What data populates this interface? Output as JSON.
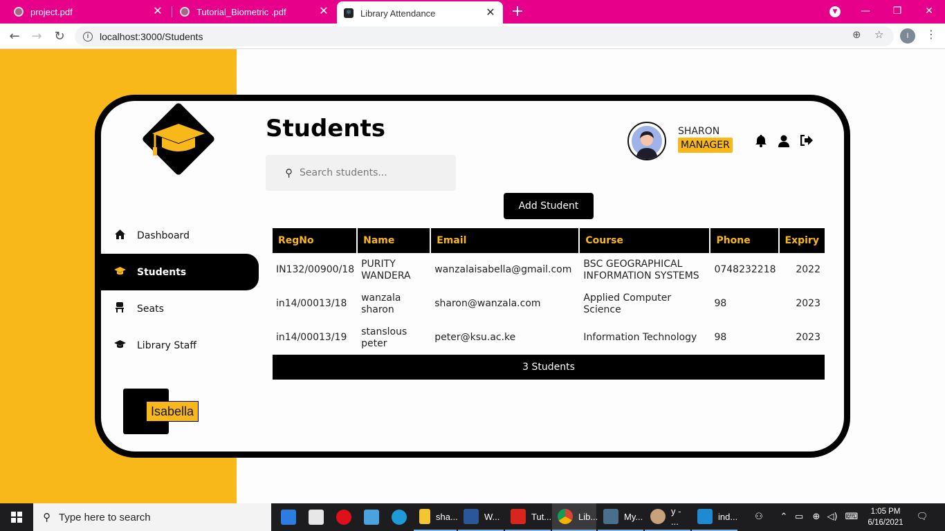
{
  "browser": {
    "tabs": [
      {
        "title": "project.pdf",
        "close": "✕"
      },
      {
        "title": "Tutorial_Biometric .pdf",
        "close": "✕"
      },
      {
        "title": "Library Attendance",
        "close": "✕"
      }
    ],
    "new_tab": "+",
    "window_controls": {
      "minimize": "—",
      "maximize": "❐",
      "close": "✕"
    },
    "url": "localhost:3000/Students",
    "profile_initial": "I"
  },
  "app": {
    "sidebar": {
      "items": [
        {
          "label": "Dashboard",
          "icon": "home-icon",
          "glyph": "⌂",
          "active": false
        },
        {
          "label": "Students",
          "icon": "graduation-cap-icon",
          "glyph": "🎓",
          "active": true
        },
        {
          "label": "Seats",
          "icon": "chair-icon",
          "glyph": "♜",
          "active": false
        },
        {
          "label": "Library Staff",
          "icon": "graduation-cap-icon",
          "glyph": "🎓",
          "active": false
        }
      ],
      "user_tag": "Isabella"
    },
    "header": {
      "title": "Students",
      "search_placeholder": "Search students...",
      "user_name": "SHARON",
      "user_role": "MANAGER"
    },
    "add_button": "Add Student",
    "table": {
      "columns": [
        "RegNo",
        "Name",
        "Email",
        "Course",
        "Phone",
        "Expiry"
      ],
      "rows": [
        {
          "regno": "IN132/00900/18",
          "name": "PURITY WANDERA",
          "email": "wanzalaisabella@gmail.com",
          "course": "BSC GEOGRAPHICAL INFORMATION SYSTEMS",
          "phone": "0748232218",
          "expiry": "2022"
        },
        {
          "regno": "in14/00013/18",
          "name": "wanzala sharon",
          "email": "sharon@wanzala.com",
          "course": "Applied Computer Science",
          "phone": "98",
          "expiry": "2023"
        },
        {
          "regno": "in14/00013/19",
          "name": "stanslous peter",
          "email": "peter@ksu.ac.ke",
          "course": "Information Technology",
          "phone": "98",
          "expiry": "2023"
        }
      ],
      "footer": "3 Students"
    },
    "colors": {
      "accent": "#f8b81a",
      "dark": "#000000",
      "browser_tab": "#e6008a"
    }
  },
  "taskbar": {
    "search_placeholder": "Type here to search",
    "apps": [
      {
        "label": "sha...",
        "icon": "folder-icon"
      },
      {
        "label": "W...",
        "icon": "word-icon"
      },
      {
        "label": "Tut...",
        "icon": "pdf-icon"
      },
      {
        "label": "Lib...",
        "icon": "chrome-icon"
      },
      {
        "label": "My...",
        "icon": "mysql-icon"
      },
      {
        "label": "y - ...",
        "icon": "paint-icon"
      },
      {
        "label": "ind...",
        "icon": "vscode-icon"
      }
    ],
    "time": "1:05 PM",
    "date": "6/16/2021"
  }
}
